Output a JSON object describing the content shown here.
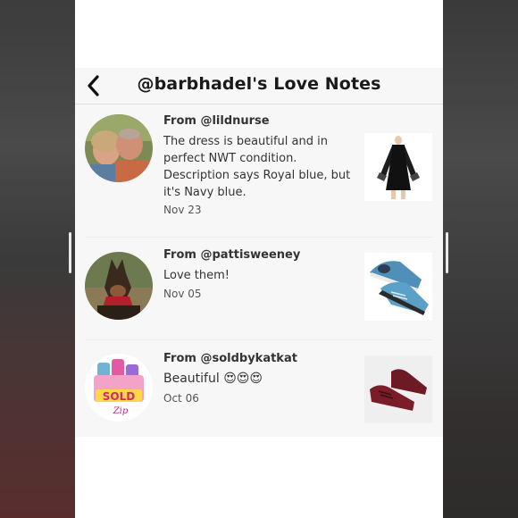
{
  "header": {
    "back_icon": "chevron-left-icon",
    "title": "@barbhadel's Love Notes"
  },
  "notes": [
    {
      "from": "From @lildnurse",
      "text": "The dress is beautiful and in perfect NWT condition. Description says Royal blue, but it's Navy blue.",
      "date": "Nov 23",
      "avatar_icon": "couple-photo-avatar",
      "thumb_icon": "black-dress-thumbnail"
    },
    {
      "from": "From @pattisweeney",
      "text": "Love them!",
      "date": "Nov 05",
      "avatar_icon": "dog-photo-avatar",
      "thumb_icon": "blue-sneakers-thumbnail"
    },
    {
      "from": "From @soldbykatkat",
      "text": "Beautiful 😍😍😍",
      "date": "Oct 06",
      "avatar_icon": "sold-logo-avatar",
      "thumb_icon": "maroon-sneakers-thumbnail"
    }
  ],
  "colors": {
    "background": "#f7f7f7",
    "text": "#333333",
    "title": "#1a1a1a"
  }
}
